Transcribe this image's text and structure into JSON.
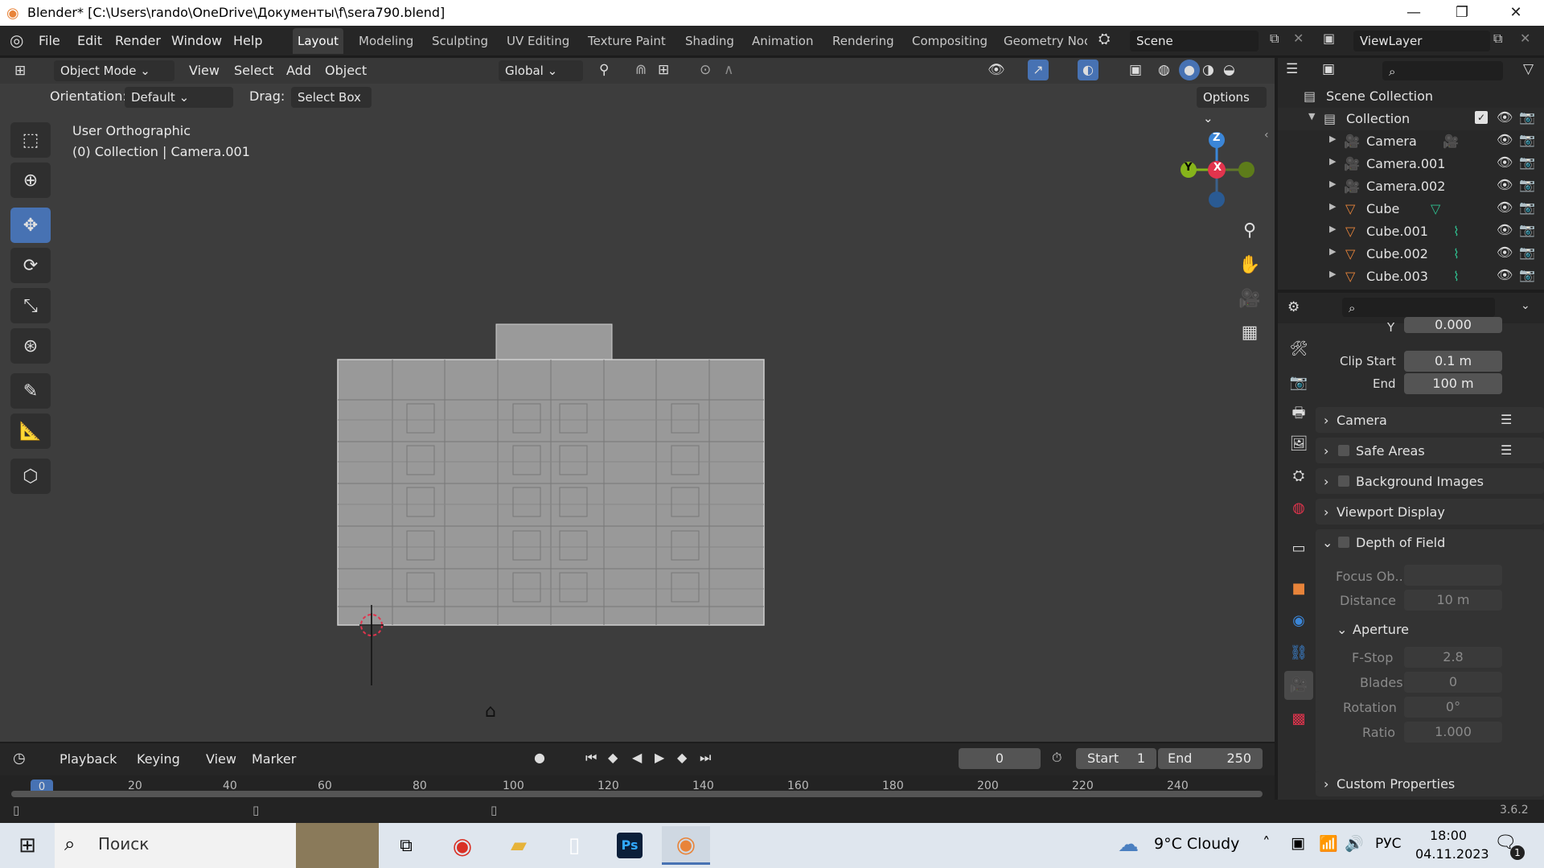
{
  "titlebar": {
    "title": "Blender* [C:\\Users\\rando\\OneDrive\\Документы\\f\\sera790.blend]",
    "min": "—",
    "max": "❐",
    "close": "✕"
  },
  "menus": [
    "File",
    "Edit",
    "Render",
    "Window",
    "Help"
  ],
  "workspaces": [
    "Layout",
    "Modeling",
    "Sculpting",
    "UV Editing",
    "Texture Paint",
    "Shading",
    "Animation",
    "Rendering",
    "Compositing",
    "Geometry Noc"
  ],
  "scene": {
    "name": "Scene",
    "viewlayer": "ViewLayer"
  },
  "viewport_header": {
    "mode": "Object Mode",
    "menus": [
      "View",
      "Select",
      "Add",
      "Object"
    ],
    "transform": "Global",
    "orientation_label": "Orientation:",
    "orientation": "Default",
    "drag_label": "Drag:",
    "drag": "Select Box",
    "options": "Options"
  },
  "viewport": {
    "view_name": "User Orthographic",
    "collection_info": "(0) Collection | Camera.001"
  },
  "gizmo": {
    "z": "Z",
    "y": "Y",
    "x": "X"
  },
  "outliner": {
    "scene_collection": "Scene Collection",
    "collection": "Collection",
    "items": [
      {
        "name": "Camera",
        "type": "camera"
      },
      {
        "name": "Camera.001",
        "type": "camera"
      },
      {
        "name": "Camera.002",
        "type": "camera"
      },
      {
        "name": "Cube",
        "type": "mesh"
      },
      {
        "name": "Cube.001",
        "type": "mesh"
      },
      {
        "name": "Cube.002",
        "type": "mesh"
      },
      {
        "name": "Cube.003",
        "type": "mesh"
      }
    ]
  },
  "properties": {
    "y_label": "Y",
    "y_value": "0.000",
    "clip_start_label": "Clip Start",
    "clip_start": "0.1 m",
    "clip_end_label": "End",
    "clip_end": "100 m",
    "panels": [
      "Camera",
      "Safe Areas",
      "Background Images",
      "Viewport Display",
      "Depth of Field"
    ],
    "focus_object_label": "Focus Ob...",
    "distance_label": "Distance",
    "distance": "10 m",
    "aperture": "Aperture",
    "fstop_label": "F-Stop",
    "fstop": "2.8",
    "blades_label": "Blades",
    "blades": "0",
    "rotation_label": "Rotation",
    "rotation": "0°",
    "ratio_label": "Ratio",
    "ratio": "1.000",
    "custom_properties": "Custom Properties"
  },
  "timeline": {
    "menus": [
      "Playback",
      "Keying",
      "View",
      "Marker"
    ],
    "current_frame": "0",
    "start_label": "Start",
    "start": "1",
    "end_label": "End",
    "end": "250",
    "ticks": [
      "0",
      "20",
      "40",
      "60",
      "80",
      "100",
      "120",
      "140",
      "160",
      "180",
      "200",
      "220",
      "240"
    ]
  },
  "status": {
    "version": "3.6.2"
  },
  "taskbar": {
    "search": "Поиск",
    "weather": "9°C  Cloudy",
    "lang": "РУС",
    "time": "18:00",
    "date": "04.11.2023",
    "notif": "1"
  },
  "colors": {
    "accent": "#4772b3",
    "orange": "#e8843a",
    "x_axis": "#e2344d",
    "y_axis": "#86b41b",
    "z_axis": "#3b86d8"
  }
}
